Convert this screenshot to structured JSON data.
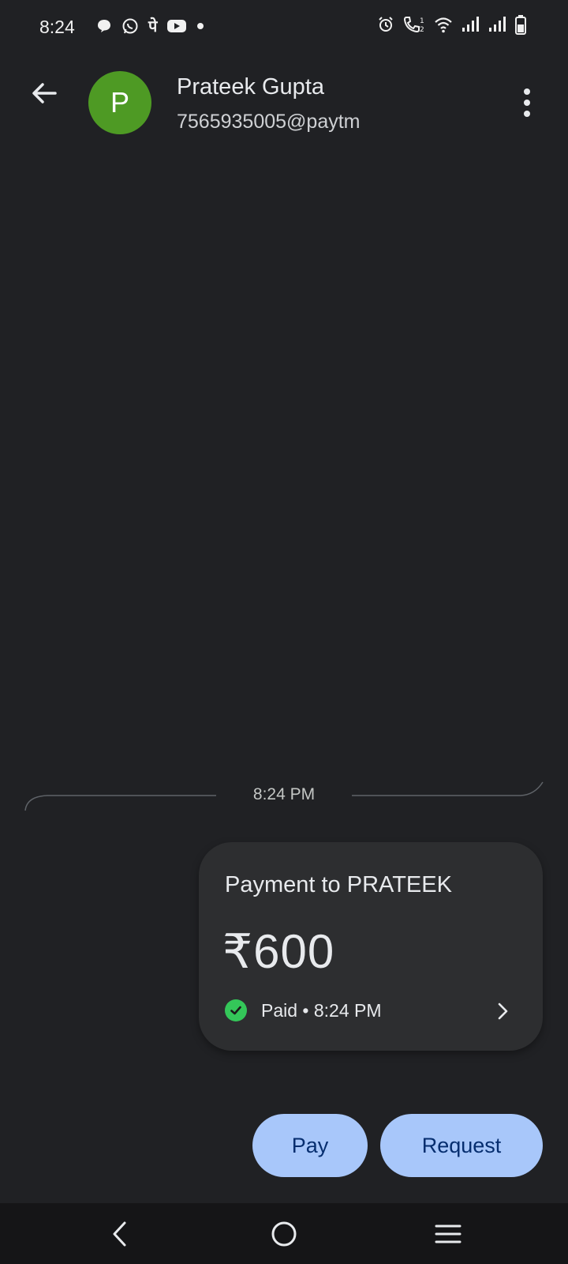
{
  "status_bar": {
    "time": "8:24",
    "left_icons": [
      "chat-bubble-icon",
      "whatsapp-icon",
      "phonepe-icon",
      "youtube-icon",
      "notification-dot-icon"
    ],
    "phonepe_glyph": "पे",
    "right_icons": [
      "alarm-icon",
      "volte-call-icon",
      "wifi-icon",
      "signal-sim1-icon",
      "signal-sim2-icon",
      "battery-icon"
    ]
  },
  "header": {
    "avatar_letter": "P",
    "avatar_color": "#4e9a24",
    "name": "Prateek Gupta",
    "upi_id": "7565935005@paytm"
  },
  "conversation": {
    "divider_time": "8:24 PM",
    "payment_card": {
      "title": "Payment to PRATEEK",
      "amount": "₹600",
      "status": "Paid • 8:24 PM",
      "status_color": "#34c759"
    }
  },
  "actions": {
    "pay_label": "Pay",
    "request_label": "Request",
    "button_color": "#a8c7fa"
  },
  "nav_bar": {
    "items": [
      "back-nav-icon",
      "home-nav-icon",
      "recents-nav-icon"
    ]
  }
}
